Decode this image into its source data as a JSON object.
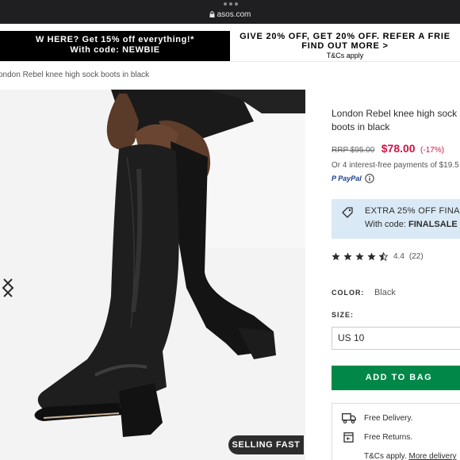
{
  "browser": {
    "url": "asos.com"
  },
  "promo": {
    "left_line1": "W HERE? Get 15% off everything!*",
    "left_line2": "With code: NEWBIE",
    "right_line1": "GIVE 20% OFF, GET 20% OFF. REFER A FRIE",
    "right_line2": "FIND OUT MORE >",
    "right_terms": "T&Cs apply"
  },
  "breadcrumb": {
    "text": "ondon Rebel knee high sock boots in black"
  },
  "gallery": {
    "badge": "SELLING FAST",
    "prev_icon": "chevron-left-icon",
    "next_icon": "chevron-right-icon"
  },
  "product": {
    "title": "London Rebel knee high sock boots in black",
    "rrp": "RRP $95.00",
    "price": "$78.00",
    "discount": "(-17%)",
    "installments": "Or 4 interest-free payments of $19.5",
    "paypal": "PayPal",
    "promo_line1": "EXTRA 25% OFF FINAL",
    "promo_prefix": "With code: ",
    "promo_code": "FINALSALE",
    "rating_value": "4.4",
    "rating_count": "(22)",
    "rating_stars": 4.4,
    "color_label": "COLOR:",
    "color_value": "Black",
    "size_label": "SIZE:",
    "size_value": "US 10",
    "add_to_bag": "ADD TO BAG",
    "free_delivery": "Free Delivery.",
    "free_returns": "Free Returns.",
    "terms_prefix": "T&Cs apply. ",
    "terms_link": "More delivery"
  },
  "colors": {
    "price_red": "#d01345",
    "add_to_bag_green": "#018849",
    "promo_box_blue": "#d9e9f6"
  }
}
